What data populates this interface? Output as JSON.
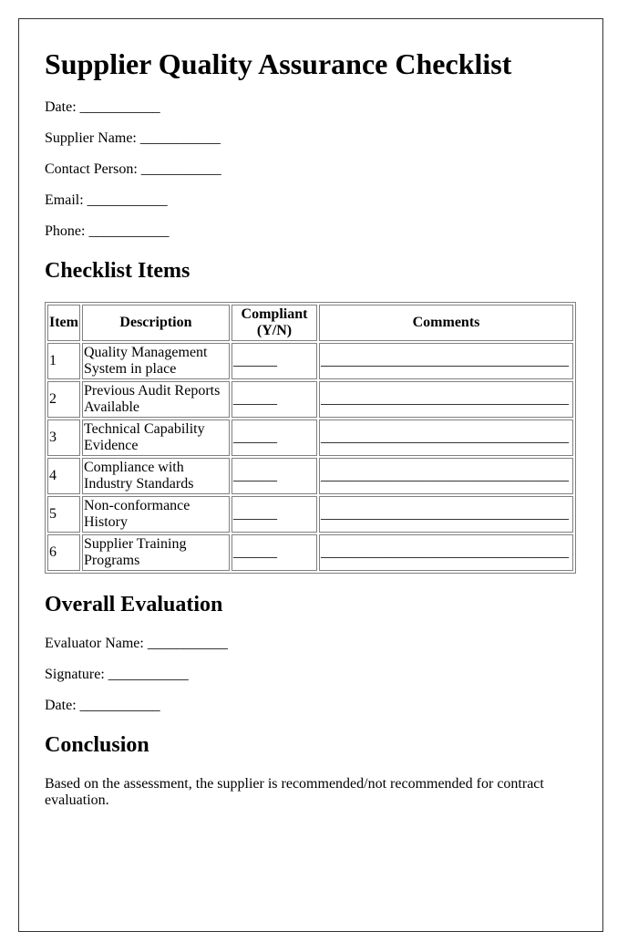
{
  "document": {
    "title": "Supplier Quality Assurance Checklist",
    "blank": "___________",
    "header_fields": [
      {
        "label": "Date:"
      },
      {
        "label": "Supplier Name:"
      },
      {
        "label": "Contact Person:"
      },
      {
        "label": "Email:"
      },
      {
        "label": "Phone:"
      }
    ],
    "checklist": {
      "heading": "Checklist Items",
      "columns": [
        "Item",
        "Description",
        "Compliant (Y/N)",
        "Comments"
      ],
      "compliant_blank": "______",
      "comments_blank": "__________________________________",
      "rows": [
        {
          "item": "1",
          "description": "Quality Management System in place"
        },
        {
          "item": "2",
          "description": "Previous Audit Reports Available"
        },
        {
          "item": "3",
          "description": "Technical Capability Evidence"
        },
        {
          "item": "4",
          "description": "Compliance with Industry Standards"
        },
        {
          "item": "5",
          "description": "Non-conformance History"
        },
        {
          "item": "6",
          "description": "Supplier Training Programs"
        }
      ]
    },
    "evaluation": {
      "heading": "Overall Evaluation",
      "fields": [
        {
          "label": "Evaluator Name:"
        },
        {
          "label": "Signature:"
        },
        {
          "label": "Date:"
        }
      ]
    },
    "conclusion": {
      "heading": "Conclusion",
      "text": "Based on the assessment, the supplier is recommended/not recommended for contract evaluation."
    }
  }
}
